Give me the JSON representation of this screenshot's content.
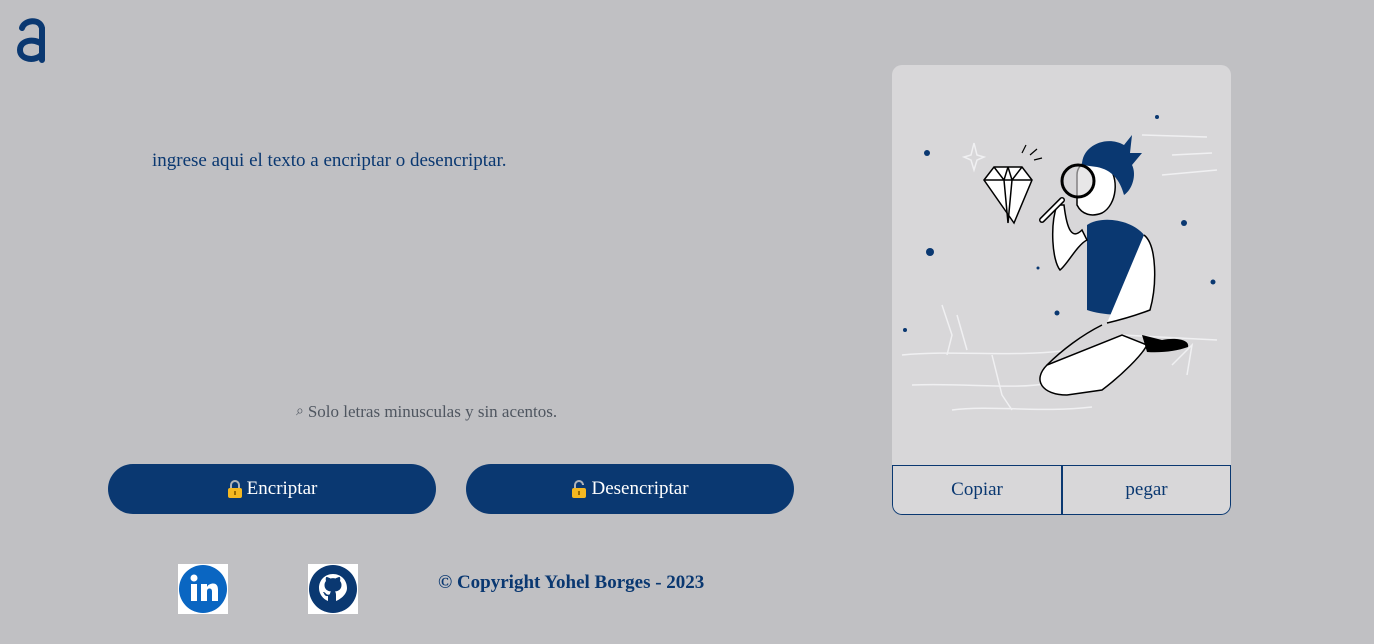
{
  "logo": {
    "icon": "alura-logo-icon",
    "color": "#0a3871"
  },
  "input": {
    "placeholder": "ingrese aqui el texto a encriptar o desencriptar."
  },
  "hint": {
    "icon": "search-icon",
    "text": "Solo letras minusculas y sin acentos."
  },
  "buttons": {
    "encrypt": {
      "icon": "lock-icon",
      "label": "Encriptar"
    },
    "decrypt": {
      "icon": "unlock-icon",
      "label": "Desencriptar"
    }
  },
  "output": {
    "illustration": "person-with-magnifying-glass-diamond-illustration",
    "copy_label": "Copiar",
    "paste_label": "pegar"
  },
  "footer": {
    "linkedin_icon": "linkedin-icon",
    "github_icon": "github-icon",
    "copyright": "© Copyright Yohel Borges - 2023"
  },
  "colors": {
    "background": "#c0c0c3",
    "primary": "#0a3871",
    "card": "#d8d7d9",
    "hint": "#4f5660"
  }
}
